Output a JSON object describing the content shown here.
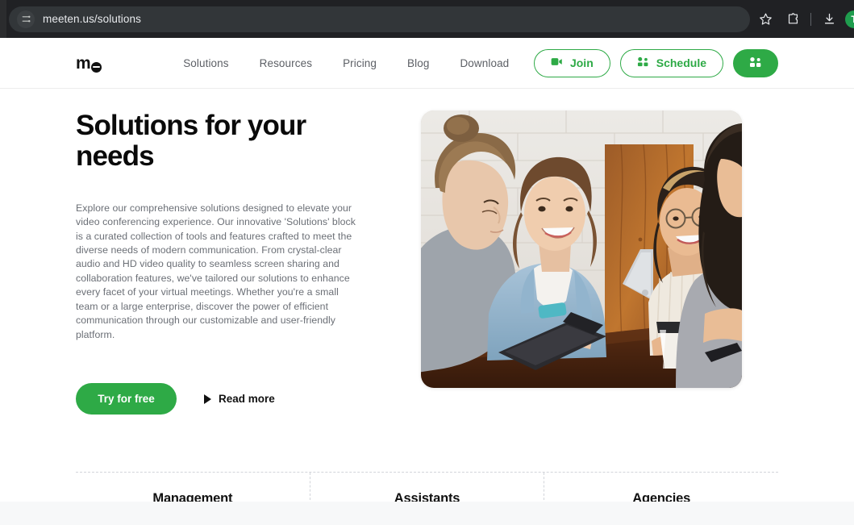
{
  "browser": {
    "url": "meeten.us/solutions",
    "site_settings_icon": "tune-sliders-icon",
    "actions": [
      {
        "name": "bookmark-star-icon",
        "label": "Bookmark"
      },
      {
        "name": "extensions-puzzle-icon",
        "label": "Extensions"
      },
      {
        "name": "downloads-icon",
        "label": "Downloads"
      }
    ],
    "profile_avatar_initial": "T",
    "avatar_color": "#1f9d4e",
    "chrome_bg": "#202124",
    "omnibox_bg": "#323639"
  },
  "site": {
    "brand": {
      "text_m": "m",
      "text_e": "e",
      "alt": "meeten logo"
    },
    "nav": [
      {
        "label": "Solutions"
      },
      {
        "label": "Resources"
      },
      {
        "label": "Pricing"
      },
      {
        "label": "Blog"
      },
      {
        "label": "Download"
      }
    ],
    "actions": {
      "join": {
        "label": "Join",
        "icon": "video-camera-icon"
      },
      "schedule": {
        "label": "Schedule",
        "icon": "people-group-icon"
      },
      "grid": {
        "icon": "grid-apps-icon"
      }
    },
    "accent_color": "#2eaa46",
    "muted_text_color": "#6b6f76"
  },
  "hero": {
    "title": "Solutions for your needs",
    "paragraph": "Explore our comprehensive solutions designed to elevate your video conferencing experience. Our innovative 'Solutions' block is a curated collection of tools and features crafted to meet the diverse needs of modern communication. From crystal-clear audio and HD video quality to seamless screen sharing and collaboration features, we've tailored our solutions to enhance every facet of your virtual meetings. Whether you're a small team or a large enterprise, discover the power of efficient communication through our customizable and user-friendly platform.",
    "primary_cta": "Try for free",
    "secondary_cta": "Read more",
    "secondary_cta_icon": "play-triangle-icon",
    "photo_alt": "Four colleagues smiling around a wooden table with a tablet and laptop"
  },
  "cards": [
    {
      "label": "Management"
    },
    {
      "label": "Assistants"
    },
    {
      "label": "Agencies"
    }
  ]
}
